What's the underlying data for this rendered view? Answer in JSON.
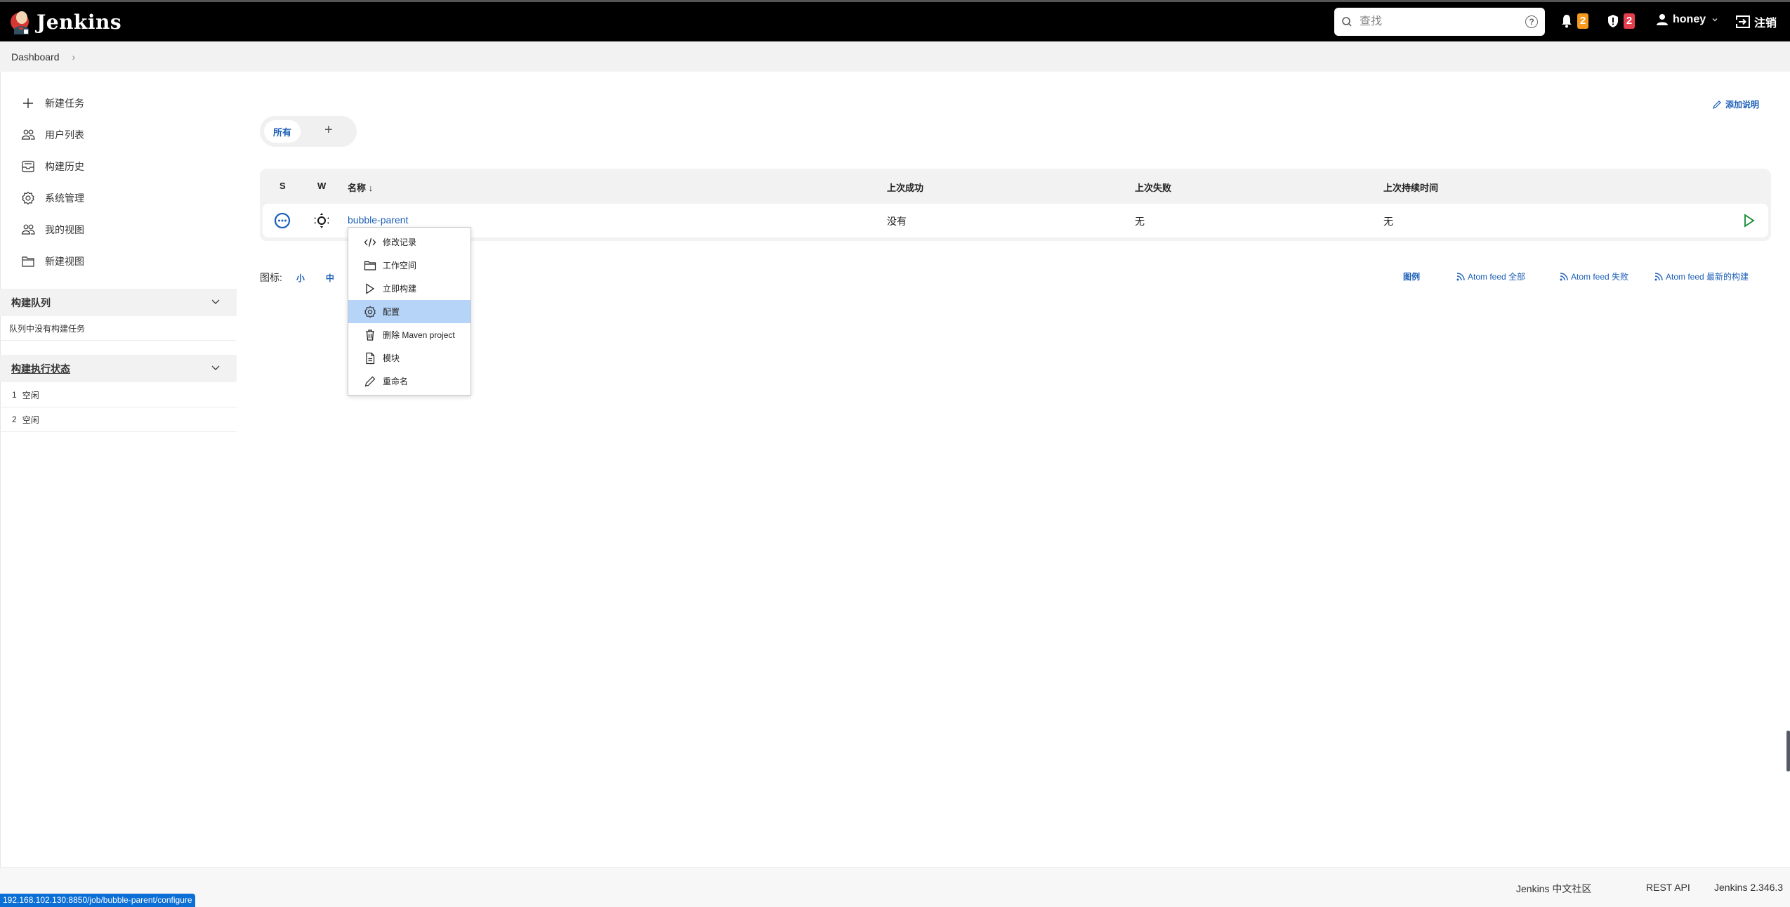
{
  "header": {
    "app_title": "Jenkins",
    "search_placeholder": "查找",
    "notifications_count": "2",
    "security_count": "2",
    "username": "honey",
    "logout_label": "注销",
    "colors": {
      "notification_badge": "#f79a1e",
      "security_badge": "#e53e4d"
    }
  },
  "breadcrumb": {
    "items": [
      "Dashboard"
    ]
  },
  "sidebar": {
    "items": [
      {
        "label": "新建任务",
        "icon": "plus-icon"
      },
      {
        "label": "用户列表",
        "icon": "users-icon"
      },
      {
        "label": "构建历史",
        "icon": "inbox-icon"
      },
      {
        "label": "系统管理",
        "icon": "gear-icon"
      },
      {
        "label": "我的视图",
        "icon": "users-icon"
      },
      {
        "label": "新建视图",
        "icon": "folder-icon"
      }
    ],
    "build_queue": {
      "title": "构建队列",
      "empty_text": "队列中没有构建任务"
    },
    "executors": {
      "title": "构建执行状态",
      "rows": [
        {
          "number": "1",
          "status": "空闲"
        },
        {
          "number": "2",
          "status": "空闲"
        }
      ]
    }
  },
  "main": {
    "add_description_label": "添加说明",
    "tabs": [
      {
        "label": "所有",
        "active": true
      }
    ],
    "add_tab_label": "+",
    "table": {
      "headers": {
        "s": "S",
        "w": "W",
        "name": "名称 ↓",
        "last_success": "上次成功",
        "last_failure": "上次失败",
        "last_duration": "上次持续时间"
      },
      "rows": [
        {
          "name": "bubble-parent",
          "last_success": "没有",
          "last_failure": "无",
          "last_duration": "无",
          "status": "not-built",
          "weather": "sunny"
        }
      ]
    },
    "icon_size": {
      "label": "图标:",
      "options": [
        "小",
        "中"
      ]
    },
    "legend_label": "图例",
    "feeds": [
      "Atom feed 全部",
      "Atom feed 失败",
      "Atom feed 最新的构建"
    ]
  },
  "context_menu": {
    "items": [
      {
        "label": "修改记录",
        "icon": "code-icon"
      },
      {
        "label": "工作空间",
        "icon": "folder-icon"
      },
      {
        "label": "立即构建",
        "icon": "play-icon"
      },
      {
        "label": "配置",
        "icon": "gear-icon",
        "highlighted": true
      },
      {
        "label": "删除 Maven project",
        "icon": "trash-icon"
      },
      {
        "label": "模块",
        "icon": "document-icon"
      },
      {
        "label": "重命名",
        "icon": "pencil-icon"
      }
    ]
  },
  "footer": {
    "community_label": "Jenkins 中文社区",
    "rest_api_label": "REST API",
    "version_label": "Jenkins 2.346.3"
  },
  "status_url": "192.168.102.130:8850/job/bubble-parent/configure"
}
